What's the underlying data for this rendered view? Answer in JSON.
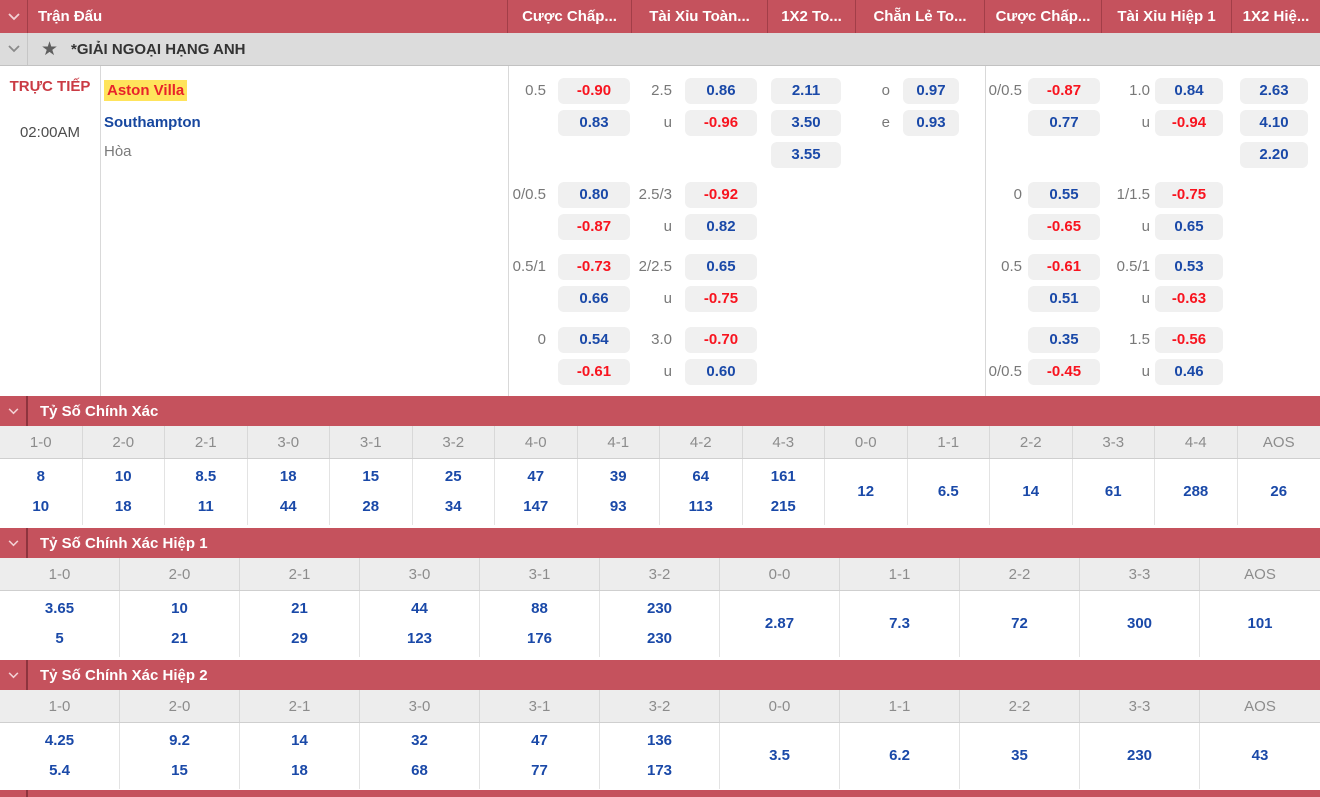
{
  "colors": {
    "header_red": "#c5525d",
    "odds_blue": "#1a49a8",
    "odds_red": "#f8141f",
    "team_highlight_yellow": "#ffe45c"
  },
  "top_header": {
    "columns": [
      {
        "label": "Trận Đấu"
      },
      {
        "label": "Cược Chấp..."
      },
      {
        "label": "Tài Xỉu Toàn..."
      },
      {
        "label": "1X2 To..."
      },
      {
        "label": "Chẵn Lẻ To..."
      },
      {
        "label": "Cược Chấp..."
      },
      {
        "label": "Tài Xỉu Hiệp 1"
      },
      {
        "label": "1X2 Hiệ..."
      }
    ]
  },
  "league_row": {
    "name": "*GIẢI NGOẠI HẠNG ANH"
  },
  "match": {
    "status": "TRỰC TIẾP",
    "time": "02:00AM",
    "home_team": "Aston Villa",
    "away_team": "Southampton",
    "draw_label": "Hòa"
  },
  "odds": {
    "u_label": "u",
    "handicap_ft": [
      {
        "label": "0.5",
        "top": "-0.90",
        "bottom": "0.83"
      },
      {
        "label": "0/0.5",
        "top": "0.80",
        "bottom": "-0.87"
      },
      {
        "label": "0.5/1",
        "top": "-0.73",
        "bottom": "0.66"
      },
      {
        "label": "0",
        "top": "0.54",
        "bottom": "-0.61"
      }
    ],
    "ou_ft": [
      {
        "label": "2.5",
        "top": "0.86",
        "bottom": "-0.96"
      },
      {
        "label": "2.5/3",
        "top": "-0.92",
        "bottom": "0.82"
      },
      {
        "label": "2/2.5",
        "top": "0.65",
        "bottom": "-0.75"
      },
      {
        "label": "3.0",
        "top": "-0.70",
        "bottom": "0.60"
      }
    ],
    "x12_ft": [
      "2.11",
      "3.50",
      "3.55"
    ],
    "odd_even": [
      {
        "label": "o",
        "val": "0.97"
      },
      {
        "label": "e",
        "val": "0.93"
      }
    ],
    "handicap_h1": [
      {
        "label": "0/0.5",
        "top": "-0.87",
        "bottom": "0.77"
      },
      {
        "label": "0",
        "top": "0.55",
        "bottom": "-0.65"
      },
      {
        "label": "0.5",
        "top": "-0.61",
        "bottom": "0.51"
      },
      {
        "label": "",
        "label_bottom": "0/0.5",
        "top": "0.35",
        "bottom": "-0.45"
      }
    ],
    "ou_h1": [
      {
        "label": "1.0",
        "top": "0.84",
        "bottom": "-0.94"
      },
      {
        "label": "1/1.5",
        "top": "-0.75",
        "bottom": "0.65"
      },
      {
        "label": "0.5/1",
        "top": "0.53",
        "bottom": "-0.63"
      },
      {
        "label": "1.5",
        "top": "-0.56",
        "bottom": "0.46"
      }
    ],
    "x12_h1": [
      "2.63",
      "4.10",
      "2.20"
    ]
  },
  "score_sections": [
    {
      "title": "Tỷ Số Chính Xác",
      "columns": [
        {
          "score": "1-0",
          "odds": [
            "8",
            "10"
          ]
        },
        {
          "score": "2-0",
          "odds": [
            "10",
            "18"
          ]
        },
        {
          "score": "2-1",
          "odds": [
            "8.5",
            "11"
          ]
        },
        {
          "score": "3-0",
          "odds": [
            "18",
            "44"
          ]
        },
        {
          "score": "3-1",
          "odds": [
            "15",
            "28"
          ]
        },
        {
          "score": "3-2",
          "odds": [
            "25",
            "34"
          ]
        },
        {
          "score": "4-0",
          "odds": [
            "47",
            "147"
          ]
        },
        {
          "score": "4-1",
          "odds": [
            "39",
            "93"
          ]
        },
        {
          "score": "4-2",
          "odds": [
            "64",
            "113"
          ]
        },
        {
          "score": "4-3",
          "odds": [
            "161",
            "215"
          ]
        },
        {
          "score": "0-0",
          "odds": [
            "12"
          ]
        },
        {
          "score": "1-1",
          "odds": [
            "6.5"
          ]
        },
        {
          "score": "2-2",
          "odds": [
            "14"
          ]
        },
        {
          "score": "3-3",
          "odds": [
            "61"
          ]
        },
        {
          "score": "4-4",
          "odds": [
            "288"
          ]
        },
        {
          "score": "AOS",
          "odds": [
            "26"
          ]
        }
      ]
    },
    {
      "title": "Tỷ Số Chính Xác Hiệp 1",
      "columns": [
        {
          "score": "1-0",
          "odds": [
            "3.65",
            "5"
          ]
        },
        {
          "score": "2-0",
          "odds": [
            "10",
            "21"
          ]
        },
        {
          "score": "2-1",
          "odds": [
            "21",
            "29"
          ]
        },
        {
          "score": "3-0",
          "odds": [
            "44",
            "123"
          ]
        },
        {
          "score": "3-1",
          "odds": [
            "88",
            "176"
          ]
        },
        {
          "score": "3-2",
          "odds": [
            "230",
            "230"
          ]
        },
        {
          "score": "0-0",
          "odds": [
            "2.87"
          ]
        },
        {
          "score": "1-1",
          "odds": [
            "7.3"
          ]
        },
        {
          "score": "2-2",
          "odds": [
            "72"
          ]
        },
        {
          "score": "3-3",
          "odds": [
            "300"
          ]
        },
        {
          "score": "AOS",
          "odds": [
            "101"
          ]
        }
      ]
    },
    {
      "title": "Tỷ Số Chính Xác Hiệp 2",
      "columns": [
        {
          "score": "1-0",
          "odds": [
            "4.25",
            "5.4"
          ]
        },
        {
          "score": "2-0",
          "odds": [
            "9.2",
            "15"
          ]
        },
        {
          "score": "2-1",
          "odds": [
            "14",
            "18"
          ]
        },
        {
          "score": "3-0",
          "odds": [
            "32",
            "68"
          ]
        },
        {
          "score": "3-1",
          "odds": [
            "47",
            "77"
          ]
        },
        {
          "score": "3-2",
          "odds": [
            "136",
            "173"
          ]
        },
        {
          "score": "0-0",
          "odds": [
            "3.5"
          ]
        },
        {
          "score": "1-1",
          "odds": [
            "6.2"
          ]
        },
        {
          "score": "2-2",
          "odds": [
            "35"
          ]
        },
        {
          "score": "3-3",
          "odds": [
            "230"
          ]
        },
        {
          "score": "AOS",
          "odds": [
            "43"
          ]
        }
      ]
    }
  ]
}
